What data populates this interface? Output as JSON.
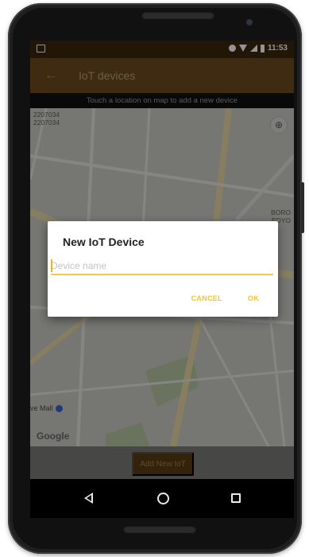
{
  "status_bar": {
    "time": "11:53"
  },
  "app_bar": {
    "title": "IoT devices",
    "back_icon": "back-arrow-icon"
  },
  "hint_bar": {
    "text": "Touch a location on map to add a new device"
  },
  "map": {
    "coordinates_line1": "2207034",
    "coordinates_line2": "2207034",
    "corner_label_line1": "BORO",
    "corner_label_line2": "EDYO",
    "place_name": "ve Mall",
    "attribution": "Google"
  },
  "add_button": {
    "label": "Add New IoT"
  },
  "dialog": {
    "title": "New IoT Device",
    "input_placeholder": "Device name",
    "cancel_label": "CANCEL",
    "ok_label": "OK"
  },
  "colors": {
    "app_bar": "#6b4a1f",
    "status_bar": "#3b260c",
    "accent": "#f5c322"
  }
}
